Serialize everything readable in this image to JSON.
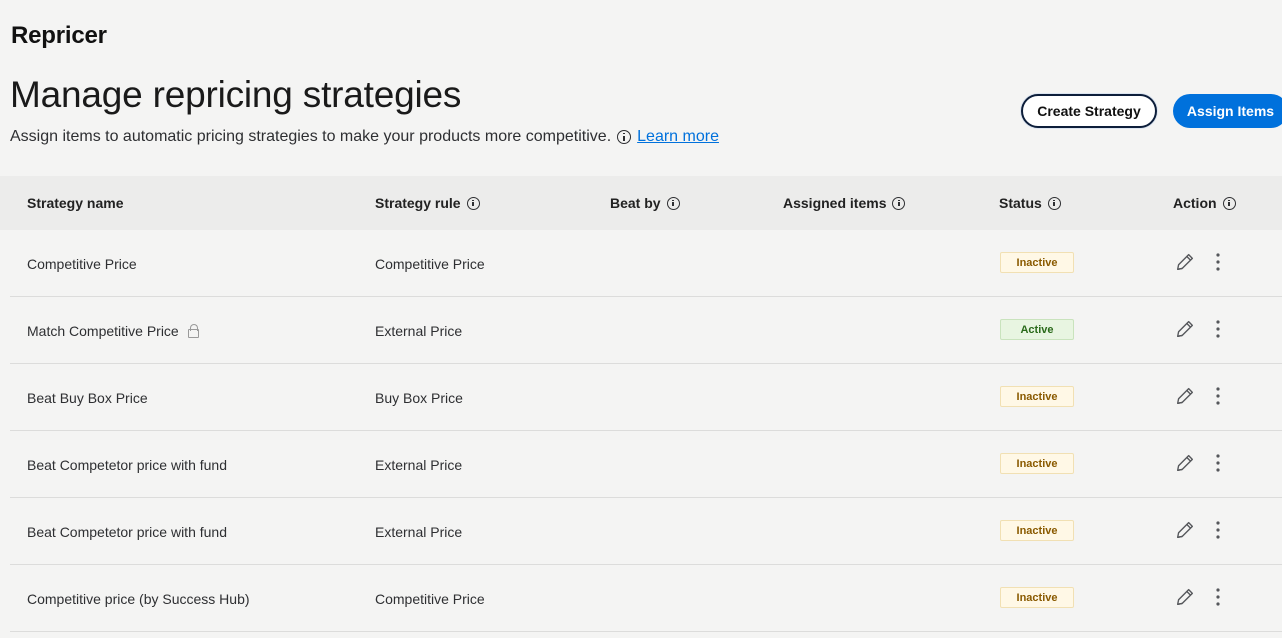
{
  "app": {
    "title": "Repricer"
  },
  "header": {
    "title": "Manage repricing strategies",
    "subtitle": "Assign items to automatic pricing strategies to make your products more competitive.",
    "learn_more": "Learn more",
    "create_button": "Create Strategy",
    "assign_button": "Assign Items"
  },
  "table": {
    "columns": [
      {
        "label": "Strategy name",
        "info": false
      },
      {
        "label": "Strategy rule",
        "info": true
      },
      {
        "label": "Beat by",
        "info": true
      },
      {
        "label": "Assigned items",
        "info": true
      },
      {
        "label": "Status",
        "info": true
      },
      {
        "label": "Action",
        "info": true
      }
    ],
    "rows": [
      {
        "name": "Competitive Price",
        "rule": "Competitive Price",
        "beat_by": "",
        "assigned": "",
        "status": "Inactive",
        "locked": false
      },
      {
        "name": "Match Competitive Price",
        "rule": "External Price",
        "beat_by": "",
        "assigned": "",
        "status": "Active",
        "locked": true
      },
      {
        "name": "Beat Buy Box Price",
        "rule": "Buy Box Price",
        "beat_by": "",
        "assigned": "",
        "status": "Inactive",
        "locked": false
      },
      {
        "name": "Beat Competetor price with fund",
        "rule": "External Price",
        "beat_by": "",
        "assigned": "",
        "status": "Inactive",
        "locked": false
      },
      {
        "name": "Beat Competetor price with fund",
        "rule": "External Price",
        "beat_by": "",
        "assigned": "",
        "status": "Inactive",
        "locked": false
      },
      {
        "name": "Competitive price (by Success Hub)",
        "rule": "Competitive Price",
        "beat_by": "",
        "assigned": "",
        "status": "Inactive",
        "locked": false
      }
    ]
  },
  "colors": {
    "accent": "#0071dc",
    "inactive_bg": "#fff8e6",
    "active_bg": "#e8f5e1"
  },
  "icons": {
    "info": "info-icon",
    "lock": "lock-icon",
    "edit": "pencil-icon",
    "more": "more-vertical-icon"
  }
}
